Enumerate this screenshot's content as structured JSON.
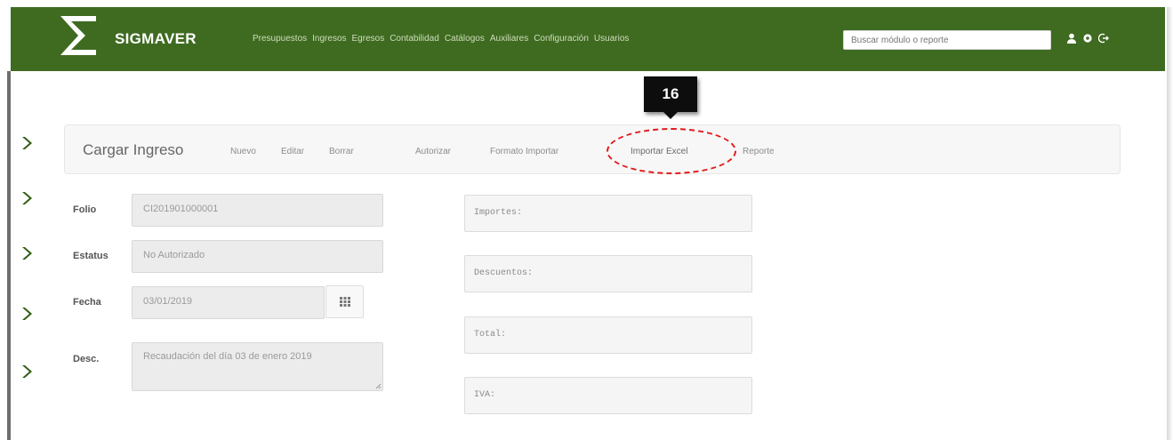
{
  "app": {
    "brand": "SIGMAVER"
  },
  "nav": {
    "items": [
      "Presupuestos",
      "Ingresos",
      "Egresos",
      "Contabilidad",
      "Catálogos",
      "Auxiliares",
      "Configuración",
      "Usuarios"
    ],
    "search_placeholder": "Buscar módulo o reporte"
  },
  "callout": {
    "number": "16"
  },
  "toolbar": {
    "title": "Cargar Ingreso",
    "actions": [
      "Nuevo",
      "Editar",
      "Borrar",
      "Autorizar",
      "Formato Importar",
      "Importar Excel",
      "Reporte"
    ],
    "highlighted": "Importar Excel"
  },
  "form": {
    "folio_label": "Folio",
    "folio_value": "CI201901000001",
    "estatus_label": "Estatus",
    "estatus_value": "No Autorizado",
    "fecha_label": "Fecha",
    "fecha_value": "03/01/2019",
    "desc_label": "Desc.",
    "desc_value": "Recaudación del día 03 de enero 2019"
  },
  "summary": {
    "importes": "Importes:",
    "descuentos": "Descuentos:",
    "total": "Total:",
    "iva": "IVA:"
  },
  "colors": {
    "navbar": "#3f6b21",
    "highlight": "#e21b1b",
    "chevron": "#2f5d12"
  },
  "icons": [
    "logo-icon",
    "user-icon",
    "gear-icon",
    "logout-icon",
    "chevron-right-icon",
    "calendar-icon"
  ]
}
